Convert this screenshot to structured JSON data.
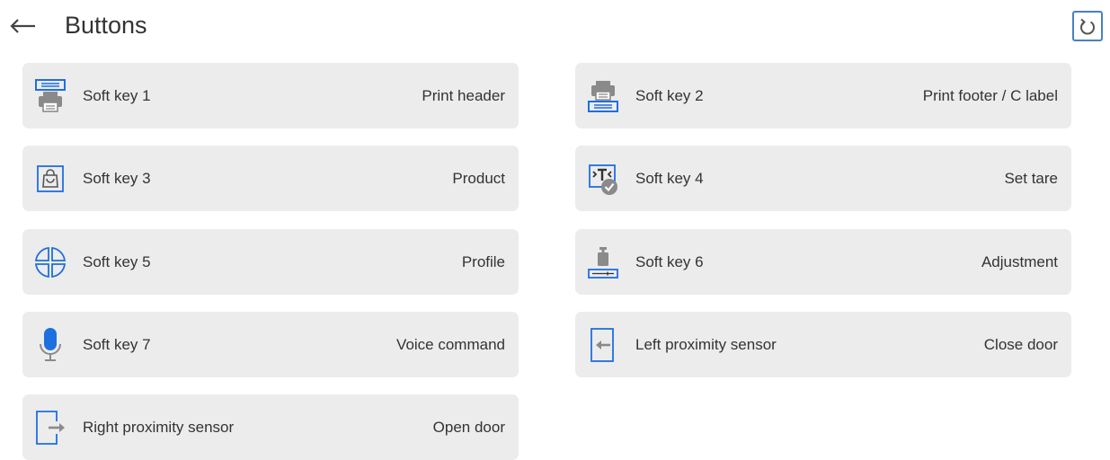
{
  "header": {
    "title": "Buttons",
    "back_icon": "arrow-left-icon",
    "reset_icon": "restore-icon"
  },
  "colors": {
    "tile_bg": "#ececec",
    "accent": "#1e6fe0",
    "icon_blue": "#4a7fc1"
  },
  "tiles": [
    {
      "key": "Soft key 1",
      "function": "Print header",
      "icon": "print-header-icon"
    },
    {
      "key": "Soft key 2",
      "function": "Print footer / C label",
      "icon": "print-footer-icon"
    },
    {
      "key": "Soft key 3",
      "function": "Product",
      "icon": "product-bag-icon"
    },
    {
      "key": "Soft key 4",
      "function": "Set tare",
      "icon": "set-tare-icon"
    },
    {
      "key": "Soft key 5",
      "function": "Profile",
      "icon": "profile-icon"
    },
    {
      "key": "Soft key 6",
      "function": "Adjustment",
      "icon": "adjustment-weight-icon"
    },
    {
      "key": "Soft key 7",
      "function": "Voice command",
      "icon": "microphone-icon"
    },
    {
      "key": "Left proximity sensor",
      "function": "Close door",
      "icon": "close-door-icon"
    },
    {
      "key": "Right proximity sensor",
      "function": "Open door",
      "icon": "open-door-icon"
    }
  ]
}
